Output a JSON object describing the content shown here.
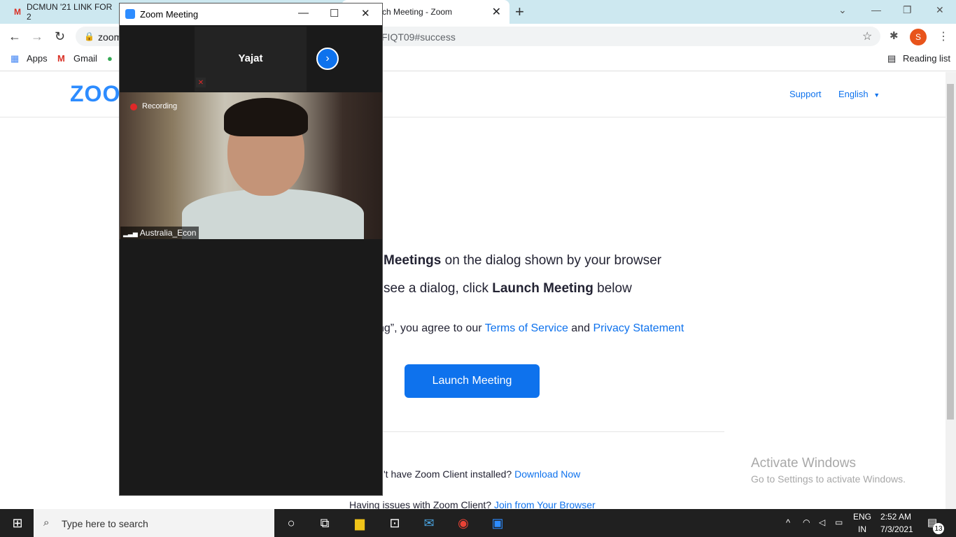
{
  "browser": {
    "tab1_title": "DCMUN '21 LINK FOR 2",
    "tab2_title": "ch Meeting - Zoom",
    "tab_close": "✕",
    "new_tab": "+",
    "url_host": "zoom",
    "url_tail": "FIQT09#success",
    "profile_initial": "S",
    "bookmarks": {
      "apps": "Apps",
      "gmail": "Gmail",
      "reading_list": "Reading list"
    }
  },
  "page": {
    "logo": "ZOO",
    "support": "Support",
    "english": "English",
    "line1_bold": "Meetings",
    "line1_rest": " on the dialog shown by your browser",
    "line2_pre": "see a dialog, click ",
    "line2_bold": "Launch Meeting",
    "line2_post": " below",
    "line3_pre": "ng”, you agree to our ",
    "terms": "Terms of Service",
    "and": " and ",
    "privacy": "Privacy Statement",
    "launch_button": "Launch Meeting",
    "download_pre": "'t have Zoom Client installed? ",
    "download_link": "Download Now",
    "issue_pre": "Having issues with Zoom Client? ",
    "issue_link": "Join from Your Browser",
    "activate_title": "Activate Windows",
    "activate_sub": "Go to Settings to activate Windows."
  },
  "zoom": {
    "window_title": "Zoom Meeting",
    "participant_name": "Yajat",
    "recording_label": "Recording",
    "video_label": "Australia_Econ"
  },
  "taskbar": {
    "search_placeholder": "Type here to search",
    "lang_top": "ENG",
    "lang_bottom": "IN",
    "time": "2:52 AM",
    "date": "7/3/2021",
    "notif_count": "13"
  }
}
